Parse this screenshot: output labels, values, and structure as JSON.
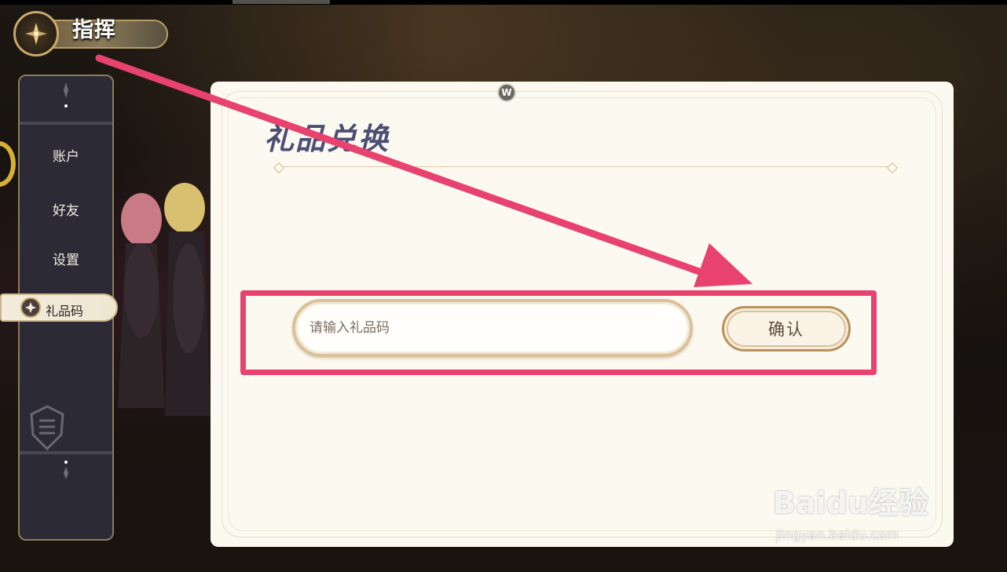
{
  "header": {
    "title": "指挥",
    "icon": "compass-icon"
  },
  "sidebar": {
    "items": [
      {
        "label": "账户"
      },
      {
        "label": "好友"
      },
      {
        "label": "设置"
      },
      {
        "label": "礼品码",
        "active": true,
        "icon": "star-icon"
      }
    ]
  },
  "panel": {
    "title": "礼品兑换",
    "close_label": "W",
    "input": {
      "placeholder": "请输入礼品码",
      "value": ""
    },
    "confirm_label": "确认"
  },
  "annotation": {
    "color": "#e8426e"
  },
  "watermark": {
    "logo_text": "Baidu经验",
    "site": "jingyan.baidu.com"
  }
}
